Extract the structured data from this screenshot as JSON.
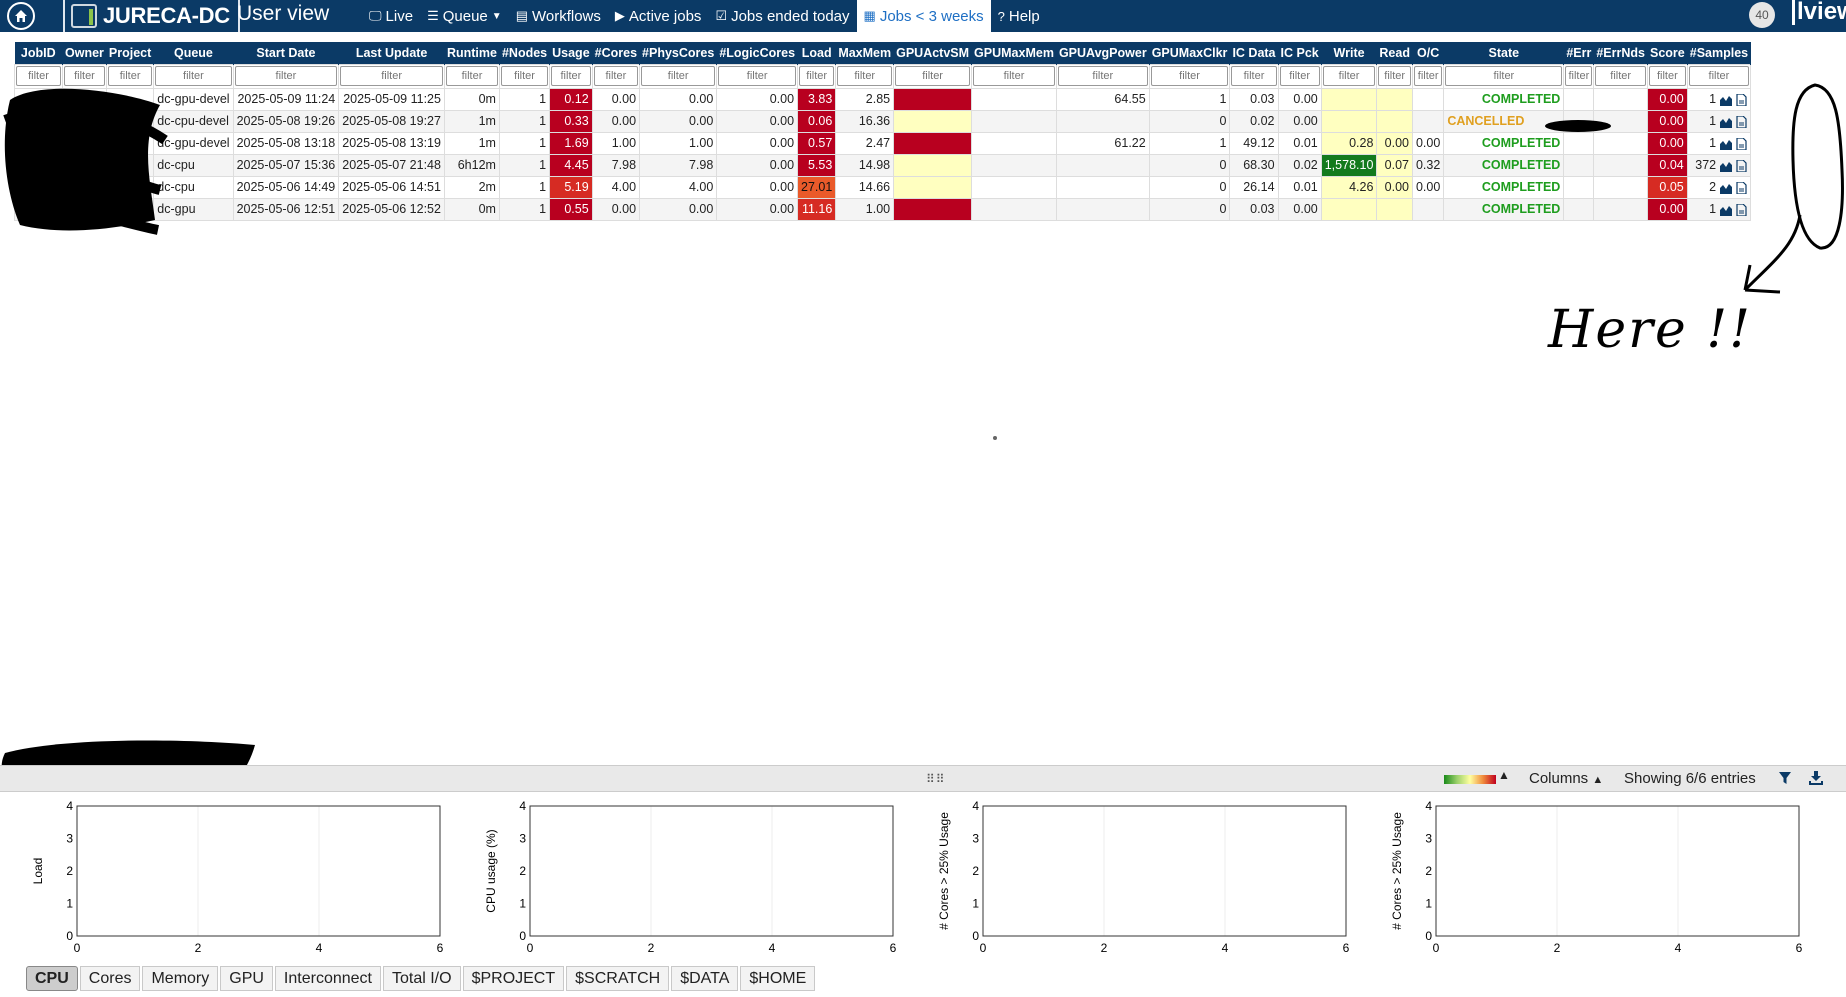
{
  "navbar": {
    "brand": "JURECA-DC",
    "view_title": "User view",
    "items": [
      {
        "label": "Live",
        "icon": "monitor-icon"
      },
      {
        "label": "Queue",
        "icon": "list-icon"
      },
      {
        "label": "Workflows",
        "icon": "table-icon"
      },
      {
        "label": "Active jobs",
        "icon": "play-icon"
      },
      {
        "label": "Jobs ended today",
        "icon": "calendar-check-icon"
      },
      {
        "label": "Jobs < 3 weeks",
        "icon": "calendar-icon"
      },
      {
        "label": "Help",
        "icon": "question-icon"
      }
    ],
    "active_item": "Jobs < 3 weeks",
    "count_badge": "40",
    "logo_text": "view"
  },
  "table": {
    "headers": [
      "JobID",
      "Owner",
      "Project",
      "Queue",
      "Start Date",
      "Last Update",
      "Runtime",
      "#Nodes",
      "Usage",
      "#Cores",
      "#PhysCores",
      "#LogicCores",
      "Load",
      "MaxMem",
      "GPUActvSM",
      "GPUMaxMem",
      "GPUAvgPower",
      "GPUMaxClkr",
      "IC Data",
      "IC Pck",
      "Write",
      "Read",
      "O/C",
      "State",
      "#Err",
      "#ErrNds",
      "Score",
      "#Samples"
    ],
    "filter_placeholder": "filter",
    "rows": [
      {
        "queue": "dc-gpu-devel",
        "start": "2025-05-09 11:24",
        "last": "2025-05-09 11:25",
        "runtime": "0m",
        "nodes": "1",
        "usage": "0.12",
        "cores": "0.00",
        "phys": "0.00",
        "logic": "0.00",
        "load": "3.83",
        "maxmem": "2.85",
        "gpuavgpower": "64.55",
        "gpumaxclkr": "1",
        "icdata": "0.03",
        "icpck": "0.00",
        "write": "",
        "read": "",
        "oc": "",
        "state": "COMPLETED",
        "score": "0.00",
        "samples": "1"
      },
      {
        "queue": "dc-cpu-devel",
        "start": "2025-05-08 19:26",
        "last": "2025-05-08 19:27",
        "runtime": "1m",
        "nodes": "1",
        "usage": "0.33",
        "cores": "0.00",
        "phys": "0.00",
        "logic": "0.00",
        "load": "0.06",
        "maxmem": "16.36",
        "gpuavgpower": "",
        "gpumaxclkr": "0",
        "icdata": "0.02",
        "icpck": "0.00",
        "write": "",
        "read": "",
        "oc": "",
        "state": "CANCELLED",
        "score": "0.00",
        "samples": "1"
      },
      {
        "queue": "dc-gpu-devel",
        "start": "2025-05-08 13:18",
        "last": "2025-05-08 13:19",
        "runtime": "1m",
        "nodes": "1",
        "usage": "1.69",
        "cores": "1.00",
        "phys": "1.00",
        "logic": "0.00",
        "load": "0.57",
        "maxmem": "2.47",
        "gpuavgpower": "61.22",
        "gpumaxclkr": "1",
        "icdata": "49.12",
        "icpck": "0.01",
        "write": "0.28",
        "read": "0.00",
        "oc": "0.00",
        "state": "COMPLETED",
        "score": "0.00",
        "samples": "1"
      },
      {
        "queue": "dc-cpu",
        "start": "2025-05-07 15:36",
        "last": "2025-05-07 21:48",
        "runtime": "6h12m",
        "nodes": "1",
        "usage": "4.45",
        "cores": "7.98",
        "phys": "7.98",
        "logic": "0.00",
        "load": "5.53",
        "maxmem": "14.98",
        "gpuavgpower": "",
        "gpumaxclkr": "0",
        "icdata": "68.30",
        "icpck": "0.02",
        "write": "1,578.10",
        "read": "0.07",
        "oc": "0.32",
        "state": "COMPLETED",
        "score": "0.04",
        "samples": "372"
      },
      {
        "queue": "dc-cpu",
        "start": "2025-05-06 14:49",
        "last": "2025-05-06 14:51",
        "runtime": "2m",
        "nodes": "1",
        "usage": "5.19",
        "cores": "4.00",
        "phys": "4.00",
        "logic": "0.00",
        "load": "27.01",
        "maxmem": "14.66",
        "gpuavgpower": "",
        "gpumaxclkr": "0",
        "icdata": "26.14",
        "icpck": "0.01",
        "write": "4.26",
        "read": "0.00",
        "oc": "0.00",
        "state": "COMPLETED",
        "score": "0.05",
        "samples": "2"
      },
      {
        "queue": "dc-gpu",
        "start": "2025-05-06 12:51",
        "last": "2025-05-06 12:52",
        "runtime": "0m",
        "nodes": "1",
        "usage": "0.55",
        "cores": "0.00",
        "phys": "0.00",
        "logic": "0.00",
        "load": "11.16",
        "maxmem": "1.00",
        "gpuavgpower": "",
        "gpumaxclkr": "0",
        "icdata": "0.03",
        "icpck": "0.00",
        "write": "",
        "read": "",
        "oc": "",
        "state": "COMPLETED",
        "score": "0.00",
        "samples": "1"
      }
    ]
  },
  "annotation": {
    "text": "Here !!"
  },
  "bottom_bar": {
    "columns_label": "Columns",
    "showing_text": "Showing 6/6 entries"
  },
  "charts": [
    {
      "ylabel": "Load",
      "xticks": [
        "0",
        "2",
        "4",
        "6"
      ],
      "yticks": [
        "0",
        "1",
        "2",
        "3",
        "4"
      ]
    },
    {
      "ylabel": "CPU usage (%)",
      "xticks": [
        "0",
        "2",
        "4",
        "6"
      ],
      "yticks": [
        "0",
        "1",
        "2",
        "3",
        "4"
      ]
    },
    {
      "ylabel": "# Cores > 25% Usage",
      "xticks": [
        "0",
        "2",
        "4",
        "6"
      ],
      "yticks": [
        "0",
        "1",
        "2",
        "3",
        "4"
      ]
    },
    {
      "ylabel": "# Cores > 25% Usage",
      "xticks": [
        "0",
        "2",
        "4",
        "6"
      ],
      "yticks": [
        "0",
        "1",
        "2",
        "3",
        "4"
      ]
    }
  ],
  "tabs": [
    "CPU",
    "Cores",
    "Memory",
    "GPU",
    "Interconnect",
    "Total I/O",
    "$PROJECT",
    "$SCRATCH",
    "$DATA",
    "$HOME"
  ],
  "active_tab": "CPU",
  "colors": {
    "navbar": "#0b3a66",
    "completed": "#1e9d1e",
    "cancelled": "#e0a020",
    "heat_red": "#b8001f",
    "heat_yellow": "#ffffc0",
    "heat_green": "#137a1d"
  }
}
